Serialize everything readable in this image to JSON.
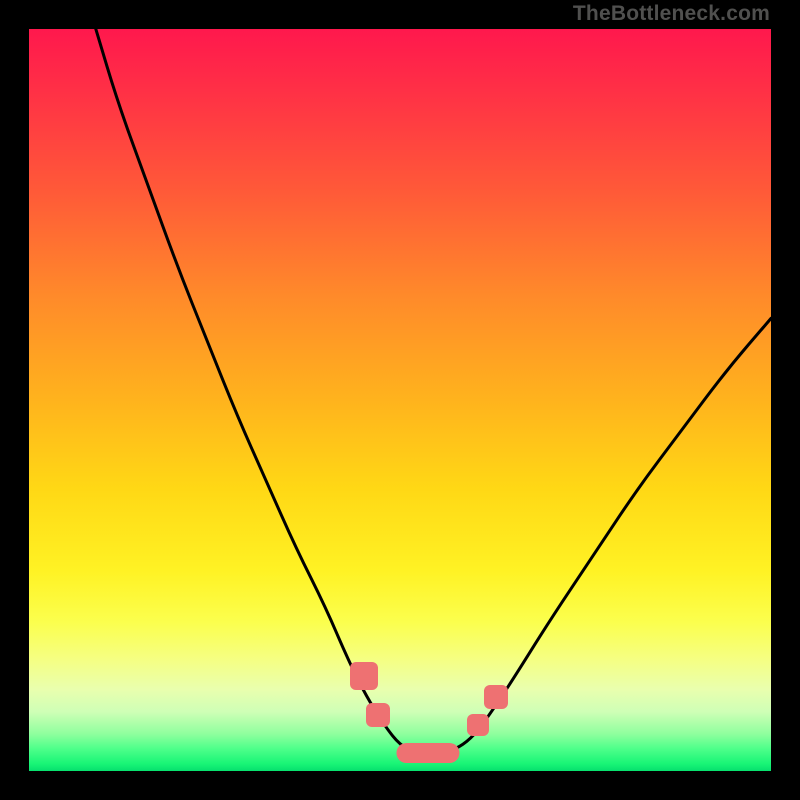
{
  "attribution": "TheBottleneck.com",
  "colors": {
    "marker": "#ee7172",
    "curve": "#000000",
    "frame": "#000000"
  },
  "chart_data": {
    "type": "line",
    "title": "",
    "xlabel": "",
    "ylabel": "",
    "xlim": [
      0,
      100
    ],
    "ylim": [
      0,
      100
    ],
    "grid": false,
    "legend": false,
    "series": [
      {
        "name": "bottleneck-curve",
        "x": [
          9,
          12,
          16,
          20,
          24,
          28,
          32,
          36,
          40,
          43,
          45.5,
          48,
          50,
          52,
          54,
          56,
          58,
          60,
          62,
          65,
          70,
          76,
          82,
          88,
          94,
          100
        ],
        "y": [
          100,
          90,
          79,
          68,
          58,
          48,
          39,
          30,
          22,
          15,
          10,
          6,
          3.5,
          2.5,
          2.3,
          2.5,
          3.2,
          4.8,
          7.5,
          12,
          20,
          29,
          38,
          46,
          54,
          61
        ]
      }
    ],
    "markers": {
      "left_outer": {
        "x": 45.2,
        "y": 12.8
      },
      "left_inner": {
        "x": 47.0,
        "y": 7.5
      },
      "bottom_row": {
        "x_start": 49.5,
        "x_end": 58.0,
        "y": 2.4
      },
      "right_inner": {
        "x": 60.5,
        "y": 6.2
      },
      "right_outer": {
        "x": 63.0,
        "y": 10.0
      }
    }
  }
}
